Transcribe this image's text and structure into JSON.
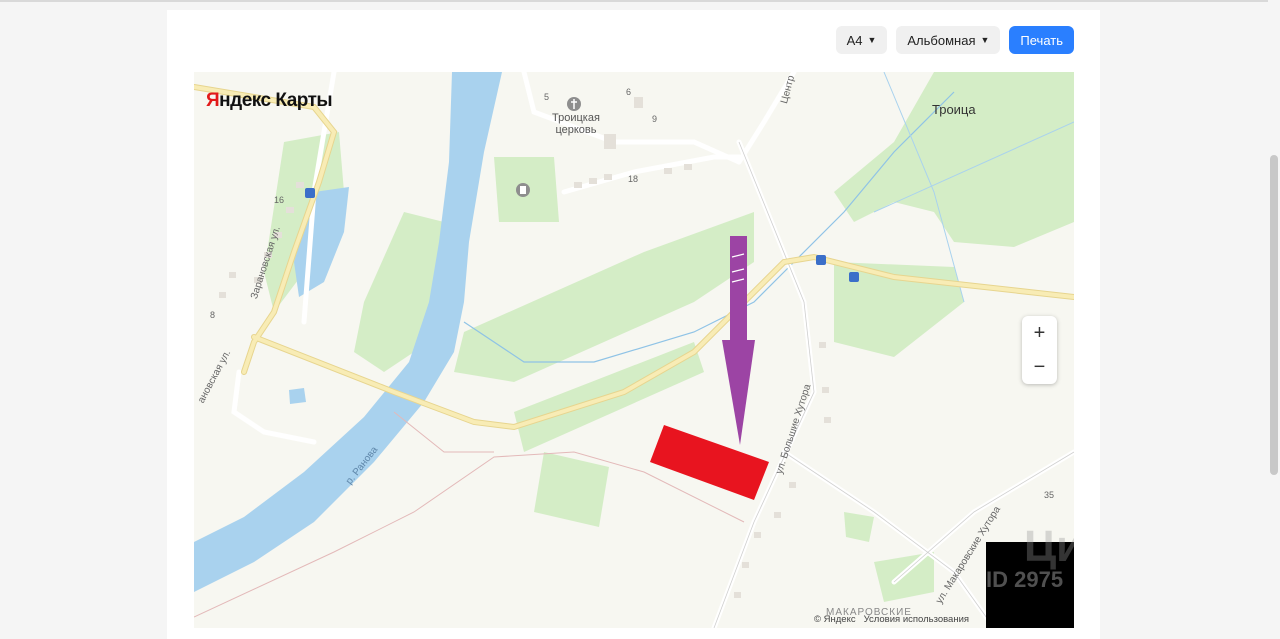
{
  "toolbar": {
    "paper_size": "A4",
    "orientation": "Альбомная",
    "print_label": "Печать"
  },
  "map": {
    "brand_first": "Я",
    "brand_rest": "ндекс Карты",
    "labels": {
      "church": "Троицкая\nцерковь",
      "village": "Троица",
      "street_zaranovskaya": "Зарановская ул.",
      "street_zaranovskaya_2": "ановская ул.",
      "street_centr": "Центр",
      "street_bolshie": "ул. Большие Хутора",
      "street_makarovskie": "ул. Макаровские Хутора",
      "river": "р. Ранова",
      "makarovskie": "МАКАРОВСКИЕ",
      "n5": "5",
      "n6": "6",
      "n9": "9",
      "n18": "18",
      "n16": "16",
      "n8": "8",
      "n35": "35",
      "bus1": "☰",
      "bus2": "☰",
      "bus3": "☰",
      "bus4": "☰"
    },
    "zoom_in": "+",
    "zoom_out": "−",
    "copyright": "© Яндекс",
    "terms": "Условия использования",
    "watermark": "Циан",
    "watermark_id": "ID 2975"
  },
  "colors": {
    "river": "#a9d2ee",
    "park": "#d4edc6",
    "road_main": "#f5e7a6",
    "marker_rect": "#e8141f",
    "arrow": "#9c44a4",
    "primary": "#2a7fff"
  },
  "icons": {
    "church": "cross-circle-icon",
    "monument": "monument-icon",
    "bus_stop": "bus-stop-icon"
  }
}
